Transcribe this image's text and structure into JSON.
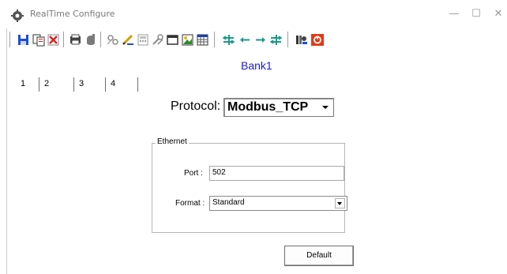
{
  "window": {
    "title": "RealTime Configure",
    "controls": {
      "minimize": "—",
      "maximize": "☐",
      "close": "✕"
    }
  },
  "toolbar": {
    "buttons": [
      {
        "name": "save-icon"
      },
      {
        "name": "copy-icon"
      },
      {
        "name": "delete-icon"
      },
      {
        "name": "print-preview-icon"
      },
      {
        "name": "hand-icon"
      },
      {
        "name": "components-icon"
      },
      {
        "name": "edit-pencil-icon"
      },
      {
        "name": "calculator-icon"
      },
      {
        "name": "tools-icon"
      },
      {
        "name": "window-icon"
      },
      {
        "name": "image-icon"
      },
      {
        "name": "grid-icon"
      },
      {
        "name": "align-icon"
      },
      {
        "name": "arrow-left-icon"
      },
      {
        "name": "arrow-right-icon"
      },
      {
        "name": "distribute-icon"
      },
      {
        "name": "config-icon"
      },
      {
        "name": "stop-icon"
      }
    ]
  },
  "bank": {
    "title": "Bank1"
  },
  "tabs": [
    {
      "label": "1"
    },
    {
      "label": "2"
    },
    {
      "label": "3"
    },
    {
      "label": "4"
    }
  ],
  "protocol": {
    "label": "Protocol:",
    "value": "Modbus_TCP"
  },
  "ethernet": {
    "legend": "Ethernet",
    "port_label": "Port :",
    "port_value": "502",
    "format_label": "Format :",
    "format_value": "Standard"
  },
  "actions": {
    "default_label": "Default"
  },
  "colors": {
    "bank_title": "#1a1ad6",
    "toolbar_teal": "#1a9a8a",
    "save_blue": "#1a4fd6",
    "stop_red": "#e03a1a"
  }
}
